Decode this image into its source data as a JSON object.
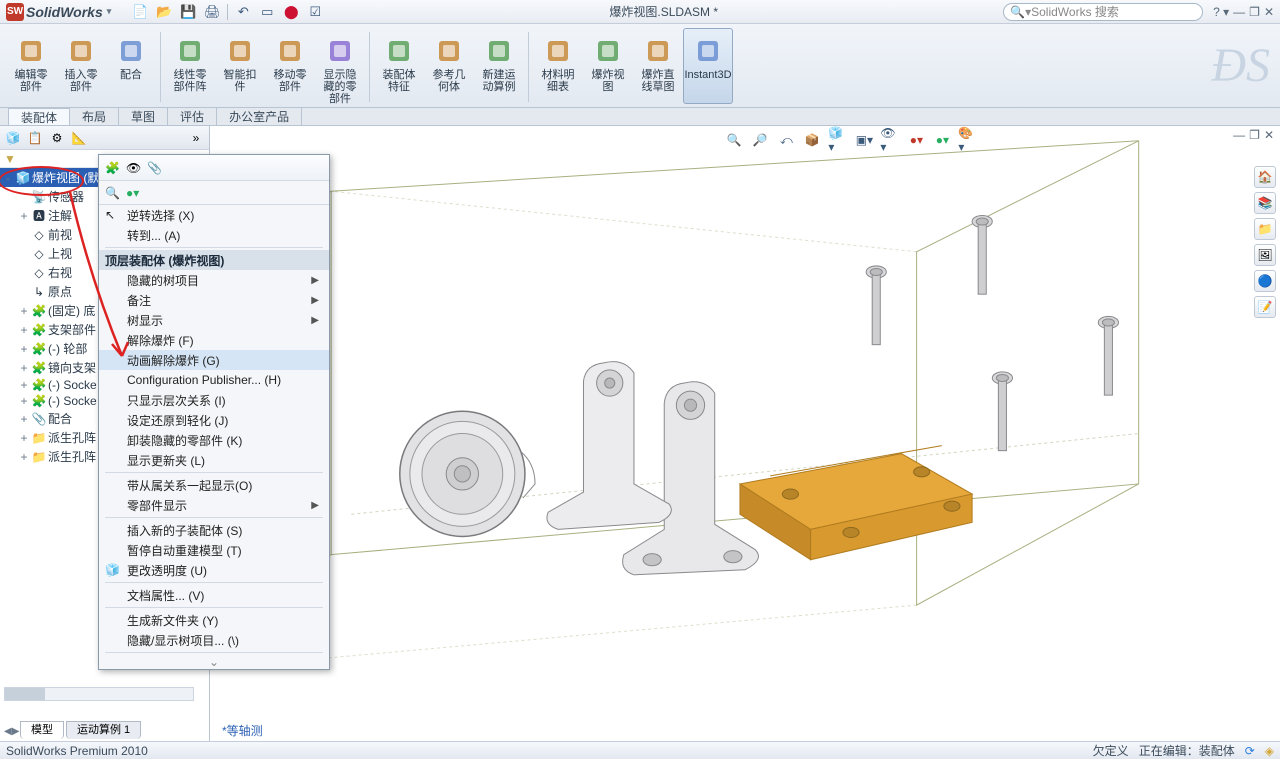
{
  "title_bar": {
    "app_name": "SolidWorks",
    "document_title": "爆炸视图.SLDASM *",
    "search_placeholder": "SolidWorks 搜索"
  },
  "ribbon": {
    "buttons": [
      {
        "id": "edit-part",
        "label": "编辑零\n部件"
      },
      {
        "id": "insert-part",
        "label": "插入零\n部件"
      },
      {
        "id": "mate",
        "label": "配合"
      },
      {
        "id": "linear-pattern",
        "label": "线性零\n部件阵"
      },
      {
        "id": "smart-fasteners",
        "label": "智能扣\n件"
      },
      {
        "id": "move-part",
        "label": "移动零\n部件"
      },
      {
        "id": "show-hide",
        "label": "显示隐\n藏的零\n部件"
      },
      {
        "id": "assembly-features",
        "label": "装配体\n特征"
      },
      {
        "id": "ref-geometry",
        "label": "参考几\n何体"
      },
      {
        "id": "new-motion",
        "label": "新建运\n动算例"
      },
      {
        "id": "bom",
        "label": "材料明\n细表"
      },
      {
        "id": "explode-view",
        "label": "爆炸视\n图"
      },
      {
        "id": "explode-sketch",
        "label": "爆炸直\n线草图"
      },
      {
        "id": "instant3d",
        "label": "Instant3D"
      }
    ]
  },
  "sec_tabs": [
    "装配体",
    "布局",
    "草图",
    "评估",
    "办公室产品"
  ],
  "tree": {
    "root": "爆炸视图  (默认<默认_显示状态",
    "items": [
      {
        "icon": "sensor",
        "label": "传感器",
        "indent": 1
      },
      {
        "icon": "annotation",
        "label": "注解",
        "indent": 1,
        "exp": "+"
      },
      {
        "icon": "plane",
        "label": "前视",
        "indent": 1
      },
      {
        "icon": "plane",
        "label": "上视",
        "indent": 1
      },
      {
        "icon": "plane",
        "label": "右视",
        "indent": 1
      },
      {
        "icon": "origin",
        "label": "原点",
        "indent": 1
      },
      {
        "icon": "part",
        "label": "(固定) 底",
        "indent": 1,
        "exp": "+"
      },
      {
        "icon": "part",
        "label": "支架部件",
        "indent": 1,
        "exp": "+"
      },
      {
        "icon": "part",
        "label": "(-) 轮部",
        "indent": 1,
        "exp": "+"
      },
      {
        "icon": "part",
        "label": "镜向支架",
        "indent": 1,
        "exp": "+"
      },
      {
        "icon": "part",
        "label": "(-) Socke",
        "indent": 1,
        "exp": "+"
      },
      {
        "icon": "part",
        "label": "(-) Socke",
        "indent": 1,
        "exp": "+"
      },
      {
        "icon": "mate",
        "label": "配合",
        "indent": 1,
        "exp": "+"
      },
      {
        "icon": "folder",
        "label": "派生孔阵",
        "indent": 1,
        "exp": "+"
      },
      {
        "icon": "folder",
        "label": "派生孔阵",
        "indent": 1,
        "exp": "+"
      }
    ]
  },
  "context_menu": {
    "items1": [
      {
        "label": "逆转选择 (X)"
      },
      {
        "label": "转到... (A)"
      }
    ],
    "header": "顶层装配体 (爆炸视图)",
    "items2": [
      {
        "label": "隐藏的树项目",
        "sub": true
      },
      {
        "label": "备注",
        "sub": true
      },
      {
        "label": "树显示",
        "sub": true
      },
      {
        "label": "解除爆炸 (F)"
      },
      {
        "label": "动画解除爆炸 (G)",
        "hl": true
      },
      {
        "label": "Configuration Publisher... (H)"
      },
      {
        "label": "只显示层次关系 (I)"
      },
      {
        "label": "设定还原到轻化 (J)"
      },
      {
        "label": "卸装隐藏的零部件 (K)"
      },
      {
        "label": "显示更新夹 (L)"
      }
    ],
    "items3": [
      {
        "label": "带从属关系一起显示(O)"
      },
      {
        "label": "零部件显示",
        "sub": true
      }
    ],
    "items4": [
      {
        "label": "插入新的子装配体 (S)"
      },
      {
        "label": "暂停自动重建模型 (T)"
      },
      {
        "label": "更改透明度 (U)"
      }
    ],
    "items5": [
      {
        "label": "文档属性... (V)"
      }
    ],
    "items6": [
      {
        "label": "生成新文件夹 (Y)"
      },
      {
        "label": "隐藏/显示树项目... (\\)"
      }
    ]
  },
  "doc_tabs": [
    "模型",
    "运动算例 1"
  ],
  "extra_text": "*等轴测",
  "status": {
    "left": "SolidWorks Premium 2010",
    "right1": "欠定义",
    "right2": "正在编辑：装配体"
  }
}
